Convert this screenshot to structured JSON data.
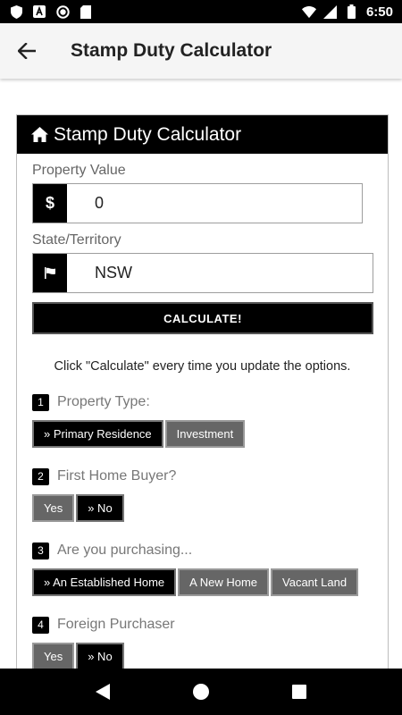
{
  "status_bar": {
    "time": "6:50",
    "left_icons": [
      "shield-icon",
      "a-box-icon",
      "circle-icon",
      "sd-card-icon"
    ],
    "right_icons": [
      "wifi-icon",
      "signal-icon",
      "battery-icon"
    ]
  },
  "app_bar": {
    "title": "Stamp Duty Calculator"
  },
  "card": {
    "header_title": "Stamp Duty Calculator",
    "property_value": {
      "label": "Property Value",
      "prefix": "$",
      "value": "0"
    },
    "state": {
      "label": "State/Territory",
      "value": "NSW"
    },
    "calculate_label": "CALCULATE!",
    "hint": "Click \"Calculate\" every time you update the options.",
    "questions": [
      {
        "num": "1",
        "text": "Property Type:",
        "options": [
          {
            "label": "» Primary Residence",
            "active": true
          },
          {
            "label": "Investment",
            "active": false
          }
        ]
      },
      {
        "num": "2",
        "text": "First Home Buyer?",
        "options": [
          {
            "label": "Yes",
            "active": false
          },
          {
            "label": "» No",
            "active": true
          }
        ]
      },
      {
        "num": "3",
        "text": "Are you purchasing...",
        "options": [
          {
            "label": "» An Established Home",
            "active": true
          },
          {
            "label": "A New Home",
            "active": false
          },
          {
            "label": "Vacant Land",
            "active": false
          }
        ]
      },
      {
        "num": "4",
        "text": "Foreign Purchaser",
        "options": [
          {
            "label": "Yes",
            "active": false
          },
          {
            "label": "» No",
            "active": true
          }
        ]
      }
    ]
  },
  "colors": {
    "primary": "#000000",
    "inactive_option": "#666666",
    "app_bar": "#f5f5f5"
  }
}
